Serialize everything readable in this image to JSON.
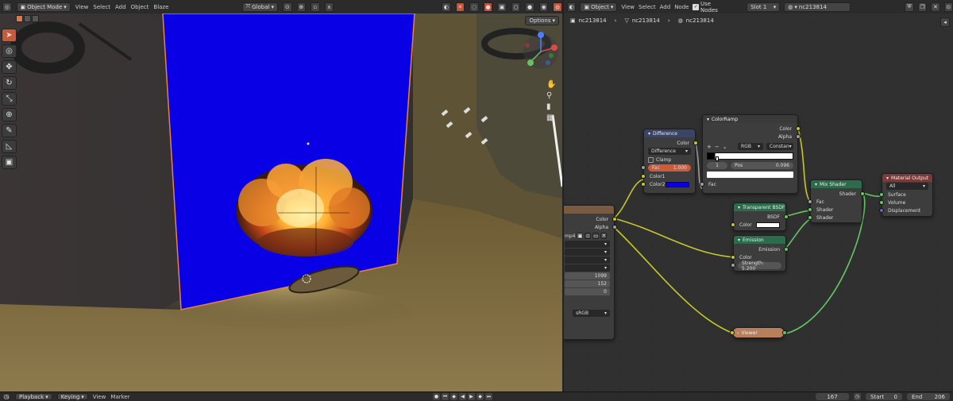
{
  "viewport_header": {
    "mode": "Object Mode",
    "menus": [
      "View",
      "Select",
      "Add",
      "Object",
      "Blaze"
    ],
    "orientation": "Global"
  },
  "viewport": {
    "options_label": "Options",
    "screen_color": "#0a00e6",
    "accent_color": "#c85a3a"
  },
  "node_header": {
    "mode": "Object",
    "menus": [
      "View",
      "Select",
      "Add",
      "Node"
    ],
    "use_nodes_label": "Use Nodes",
    "slot": "Slot 1",
    "material": "nc213814"
  },
  "breadcrumbs": [
    "nc213814",
    "nc213814",
    "nc213814"
  ],
  "nodes": {
    "difference": {
      "title": "Difference",
      "out_color": "Color",
      "blend": "Difference",
      "clamp": "Clamp",
      "fac_label": "Fac",
      "fac_value": "1.000",
      "color1": "Color1",
      "color2": "Color2",
      "color2_swatch": "#0a00e6"
    },
    "colorramp": {
      "title": "ColorRamp",
      "out_color": "Color",
      "out_alpha": "Alpha",
      "color_mode": "RGB",
      "interpolation": "Constan",
      "stop_index": "1",
      "pos_label": "Pos",
      "pos_value": "0.096",
      "in_fac": "Fac"
    },
    "transparent": {
      "title": "Transparent BSDF",
      "out_bsdf": "BSDF",
      "in_color": "Color"
    },
    "emission": {
      "title": "Emission",
      "out_emission": "Emission",
      "in_color": "Color",
      "strength": "Strength: 5.200"
    },
    "mixshader": {
      "title": "Mix Shader",
      "out_shader": "Shader",
      "in_fac": "Fac",
      "in_shader1": "Shader",
      "in_shader2": "Shader"
    },
    "output": {
      "title": "Material Output",
      "target": "All",
      "surface": "Surface",
      "volume": "Volume",
      "displacement": "Displacement"
    },
    "image": {
      "out_color": "Color",
      "out_alpha": "Alpha",
      "file": "mp4",
      "frames": "1099",
      "start": "152",
      "offset": "0",
      "colorspace": "sRGB"
    },
    "viewer": {
      "title": "Viewer"
    }
  },
  "timeline": {
    "menus": [
      "Playback",
      "Keying",
      "View",
      "Marker"
    ],
    "current_frame": "167",
    "start_label": "Start",
    "start_value": "0",
    "end_label": "End",
    "end_value": "206"
  }
}
